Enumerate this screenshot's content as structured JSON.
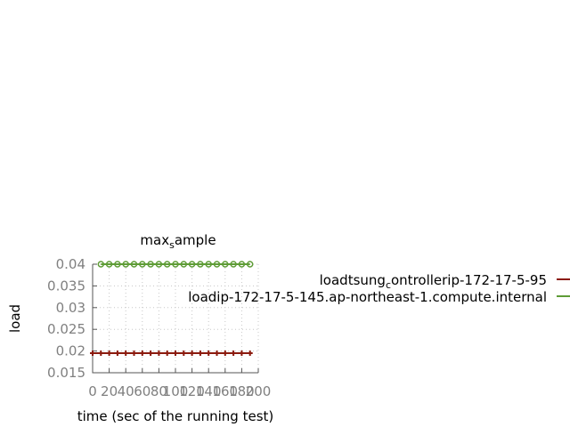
{
  "chart_data": {
    "type": "line",
    "title_parts": [
      "max",
      "s",
      "ample"
    ],
    "xlabel": "time (sec of the running test)",
    "ylabel": "load",
    "xlim": [
      0,
      200
    ],
    "ylim": [
      0.015,
      0.04
    ],
    "xticks": [
      "0",
      "20",
      "40",
      "60",
      "80",
      "100",
      "120",
      "140",
      "160",
      "180",
      "200"
    ],
    "yticks": [
      "0.015",
      "0.02",
      "0.025",
      "0.03",
      "0.035",
      "0.04"
    ],
    "grid": true,
    "legend_placement": "outside-right",
    "series": [
      {
        "name_parts": [
          "loadtsung",
          "c",
          "ontrollerip-172-17-5-95"
        ],
        "color": "#8b1a0e",
        "marker": "plus",
        "x": [
          0,
          10,
          20,
          30,
          40,
          50,
          60,
          70,
          80,
          90,
          100,
          110,
          120,
          130,
          140,
          150,
          160,
          170,
          180,
          190
        ],
        "y": [
          0.0195,
          0.0195,
          0.0195,
          0.0195,
          0.0195,
          0.0195,
          0.0195,
          0.0195,
          0.0195,
          0.0195,
          0.0195,
          0.0195,
          0.0195,
          0.0195,
          0.0195,
          0.0195,
          0.0195,
          0.0195,
          0.0195,
          0.0195
        ]
      },
      {
        "name_parts": [
          "loadip-172-17-5-145.ap-northeast-1.compute.internal"
        ],
        "color": "#5e9c36",
        "marker": "circle",
        "x": [
          10,
          20,
          30,
          40,
          50,
          60,
          70,
          80,
          90,
          100,
          110,
          120,
          130,
          140,
          150,
          160,
          170,
          180,
          190
        ],
        "y": [
          0.04,
          0.04,
          0.04,
          0.04,
          0.04,
          0.04,
          0.04,
          0.04,
          0.04,
          0.04,
          0.04,
          0.04,
          0.04,
          0.04,
          0.04,
          0.04,
          0.04,
          0.04,
          0.04
        ]
      }
    ]
  }
}
